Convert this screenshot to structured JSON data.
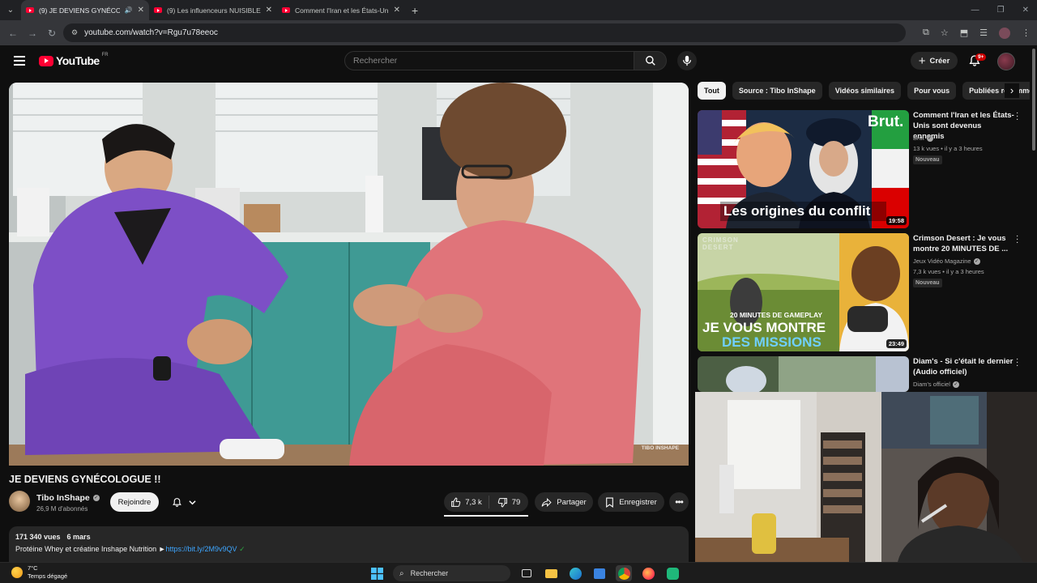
{
  "browser": {
    "tabs": [
      {
        "title": "(9) JE DEVIENS GYNÉCOLO",
        "active": true
      },
      {
        "title": "(9) Les influenceurs NUISIBLES",
        "active": false
      },
      {
        "title": "Comment l'Iran et les États-Uni",
        "active": false
      }
    ],
    "url": "youtube.com/watch?v=Rgu7u78eeoc"
  },
  "header": {
    "logo_text": "YouTube",
    "logo_country": "FR",
    "search_placeholder": "Rechercher",
    "create_label": "Créer",
    "notif_count": "9+"
  },
  "video": {
    "title": "JE DEVIENS GYNÉCOLOGUE !!",
    "watermark": "TIBO INSHAPE",
    "channel": "Tibo InShape",
    "subscribers": "26,9 M d'abonnés",
    "join_label": "Rejoindre",
    "likes": "7,3 k",
    "dislikes": "79",
    "share_label": "Partager",
    "save_label": "Enregistrer",
    "views": "171 340 vues",
    "date": "6 mars",
    "description": "Protéine Whey et créatine Inshape Nutrition ►",
    "link": "https://bit.ly/2M9v9QV"
  },
  "chips": [
    "Tout",
    "Source : Tibo InShape",
    "Vidéos similaires",
    "Pour vous",
    "Publiées récemment"
  ],
  "recommendations": [
    {
      "title": "Comment l'Iran et les États-Unis sont devenus ennemis",
      "channel": "Brut",
      "meta": "13 k vues • il y a 3 heures",
      "badge": "Nouveau",
      "duration": "19:58",
      "thumb_caption": "Les origines du conflit",
      "thumb_brand": "Brut."
    },
    {
      "title": "Crimson Desert : Je vous montre 20 MINUTES DE ...",
      "channel": "Jeux Vidéo Magazine",
      "meta": "7,3 k vues • il y a 3 heures",
      "badge": "Nouveau",
      "duration": "23:49",
      "thumb_line1": "20 MINUTES DE GAMEPLAY",
      "thumb_line2": "JE VOUS MONTRE",
      "thumb_line3": "DES MISSIONS",
      "thumb_logo": "CRIMSON DESERT"
    },
    {
      "title": "Diam's - Si c'était le dernier (Audio officiel)",
      "channel": "Diam's officiel"
    }
  ],
  "taskbar": {
    "temperature": "7°C",
    "weather": "Temps dégagé",
    "search_label": "Rechercher"
  },
  "colors": {
    "background": "#0f0f0f",
    "accent_red": "#ff0033",
    "link_blue": "#3ea6ff"
  }
}
